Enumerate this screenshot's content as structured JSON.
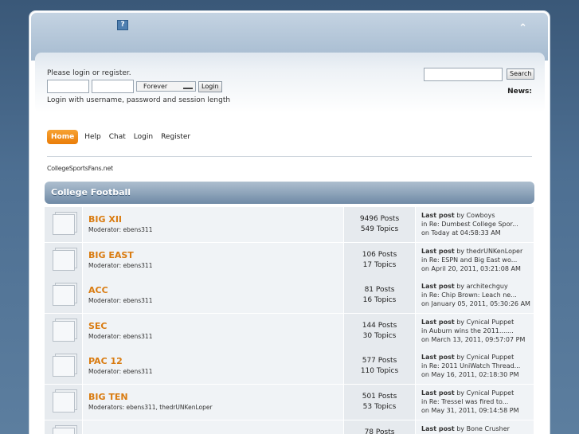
{
  "header": {
    "help_glyph": "?",
    "collapse_glyph": "⌃"
  },
  "user": {
    "prompt": "Please login or register.",
    "session_option": "Forever",
    "login_button": "Login",
    "hint": "Login with username, password and session length"
  },
  "search": {
    "button": "Search"
  },
  "news": {
    "label": "News:"
  },
  "menu": {
    "items": [
      {
        "label": "Home"
      },
      {
        "label": "Help"
      },
      {
        "label": "Chat"
      },
      {
        "label": "Login"
      },
      {
        "label": "Register"
      }
    ]
  },
  "linktree": "CollegeSportsFans.net",
  "category": {
    "title": "College Football"
  },
  "boards": [
    {
      "name": "BIG XII",
      "moderator": "Moderator: ebens311",
      "posts": "9496 Posts",
      "topics": "549 Topics",
      "last_label": "Last post",
      "last_by": " by Cowboys",
      "last_in": "in Re: Dumbest College Spor...",
      "last_on": "on Today at 04:58:33 AM"
    },
    {
      "name": "BIG EAST",
      "moderator": "Moderator: ebens311",
      "posts": "106 Posts",
      "topics": "17 Topics",
      "last_label": "Last post",
      "last_by": " by thedrUNKenLoper",
      "last_in": "in Re: ESPN and Big East wo...",
      "last_on": "on April 20, 2011, 03:21:08 AM"
    },
    {
      "name": "ACC",
      "moderator": "Moderator: ebens311",
      "posts": "81 Posts",
      "topics": "16 Topics",
      "last_label": "Last post",
      "last_by": " by architechguy",
      "last_in": "in Re: Chip Brown: Leach ne...",
      "last_on": "on January 05, 2011, 05:30:26 AM"
    },
    {
      "name": "SEC",
      "moderator": "Moderator: ebens311",
      "posts": "144 Posts",
      "topics": "30 Topics",
      "last_label": "Last post",
      "last_by": " by Cynical Puppet",
      "last_in": "in Auburn wins the 2011.......",
      "last_on": "on March 13, 2011, 09:57:07 PM"
    },
    {
      "name": "PAC 12",
      "moderator": "Moderator: ebens311",
      "posts": "577 Posts",
      "topics": "110 Topics",
      "last_label": "Last post",
      "last_by": " by Cynical Puppet",
      "last_in": "in Re: 2011 UniWatch Thread...",
      "last_on": "on May 16, 2011, 02:18:30 PM"
    },
    {
      "name": "BIG TEN",
      "moderator": "Moderators: ebens311, thedrUNKenLoper",
      "posts": "501 Posts",
      "topics": "53 Topics",
      "last_label": "Last post",
      "last_by": " by Cynical Puppet",
      "last_in": "in Re: Tressel was fired to...",
      "last_on": "on May 31, 2011, 09:14:58 PM"
    },
    {
      "name": "",
      "moderator": "",
      "posts": "78 Posts",
      "topics": "",
      "last_label": "Last post",
      "last_by": " by Bone Crusher",
      "last_in": "",
      "last_on": ""
    }
  ]
}
